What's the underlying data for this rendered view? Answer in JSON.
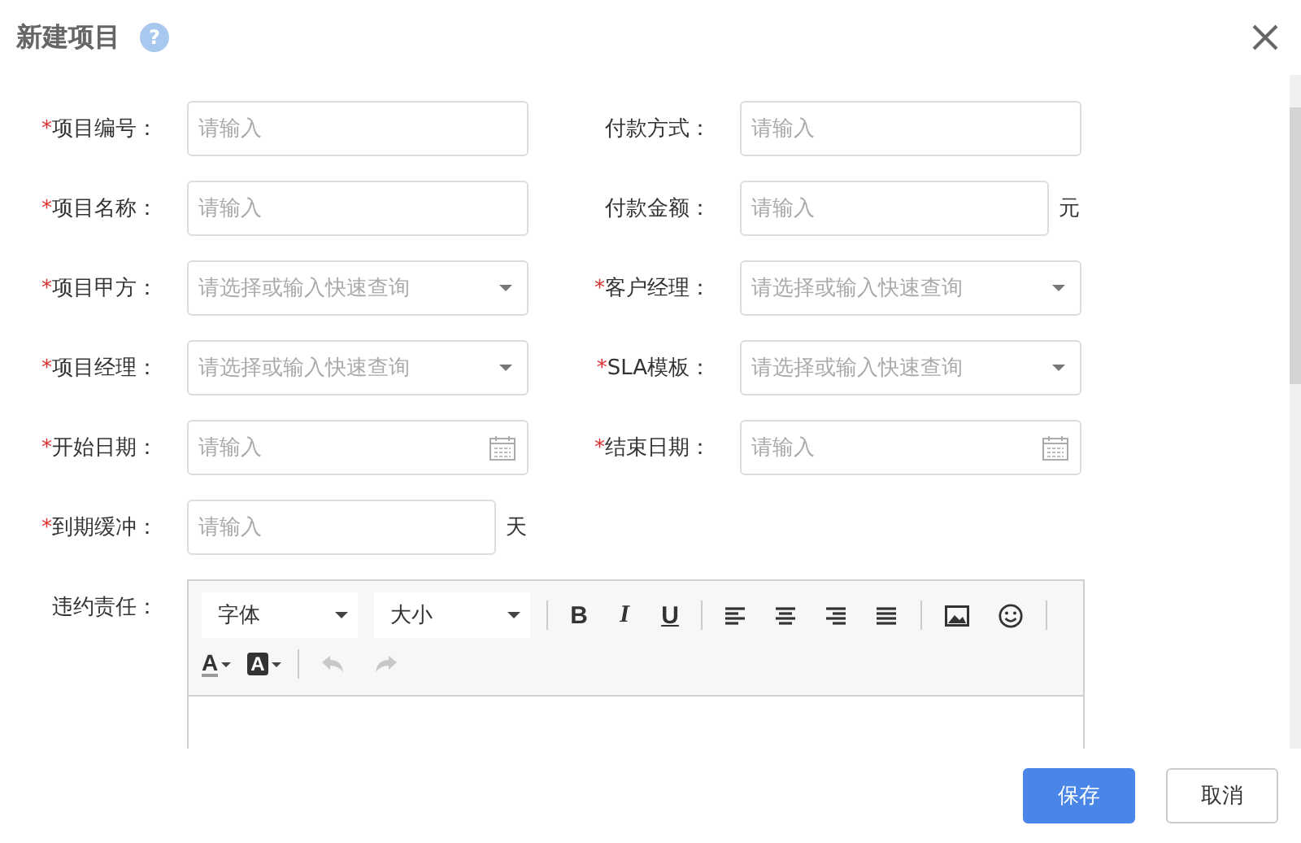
{
  "dialog": {
    "title": "新建项目",
    "help": "?"
  },
  "rows": [
    {
      "left": {
        "mark": "*",
        "label": "项目编号：",
        "kind": "text",
        "placeholder": "请输入"
      },
      "right": {
        "label": "付款方式：",
        "kind": "text",
        "placeholder": "请输入"
      }
    },
    {
      "left": {
        "mark": "*",
        "label": "项目名称：",
        "kind": "text",
        "placeholder": "请输入"
      },
      "right": {
        "label": "付款金额：",
        "kind": "text",
        "placeholder": "请输入",
        "unit": "元"
      }
    },
    {
      "left": {
        "mark": "*",
        "label": "项目甲方：",
        "kind": "select",
        "placeholder": "请选择或输入快速查询"
      },
      "right": {
        "mark": "*",
        "label": "客户经理：",
        "kind": "select",
        "placeholder": "请选择或输入快速查询"
      }
    },
    {
      "left": {
        "mark": "*",
        "label": "项目经理：",
        "kind": "select",
        "placeholder": "请选择或输入快速查询"
      },
      "right": {
        "mark": "*",
        "label": "SLA模板：",
        "kind": "select",
        "placeholder": "请选择或输入快速查询"
      }
    },
    {
      "left": {
        "mark": "*",
        "label": "开始日期：",
        "kind": "date",
        "placeholder": "请输入"
      },
      "right": {
        "mark": "*",
        "label": "结束日期：",
        "kind": "date",
        "placeholder": "请输入"
      }
    },
    {
      "left": {
        "mark": "*",
        "label": "到期缓冲：",
        "kind": "text",
        "placeholder": "请输入",
        "unit": "天"
      }
    }
  ],
  "editor": {
    "label": "违约责任：",
    "toolbar": [
      [
        {
          "kind": "select",
          "label": "字体"
        },
        {
          "kind": "select",
          "label": "大小"
        },
        {
          "kind": "sep"
        },
        {
          "kind": "bold",
          "glyph": "B"
        },
        {
          "kind": "italic",
          "glyph": "I"
        },
        {
          "kind": "underline",
          "glyph": "U"
        },
        {
          "kind": "sep"
        },
        {
          "kind": "align-left"
        },
        {
          "kind": "align-center"
        },
        {
          "kind": "align-right"
        },
        {
          "kind": "align-justify"
        },
        {
          "kind": "sep"
        },
        {
          "kind": "image"
        },
        {
          "kind": "emoji"
        },
        {
          "kind": "sep"
        }
      ],
      [
        {
          "kind": "font-color",
          "glyph": "A"
        },
        {
          "kind": "back-color",
          "glyph": "A"
        },
        {
          "kind": "sep"
        },
        {
          "kind": "undo",
          "disabled": true
        },
        {
          "kind": "redo",
          "disabled": true
        }
      ]
    ]
  },
  "buttons": [
    {
      "label": "保存",
      "primary": true
    },
    {
      "label": "取消",
      "primary": false
    }
  ]
}
